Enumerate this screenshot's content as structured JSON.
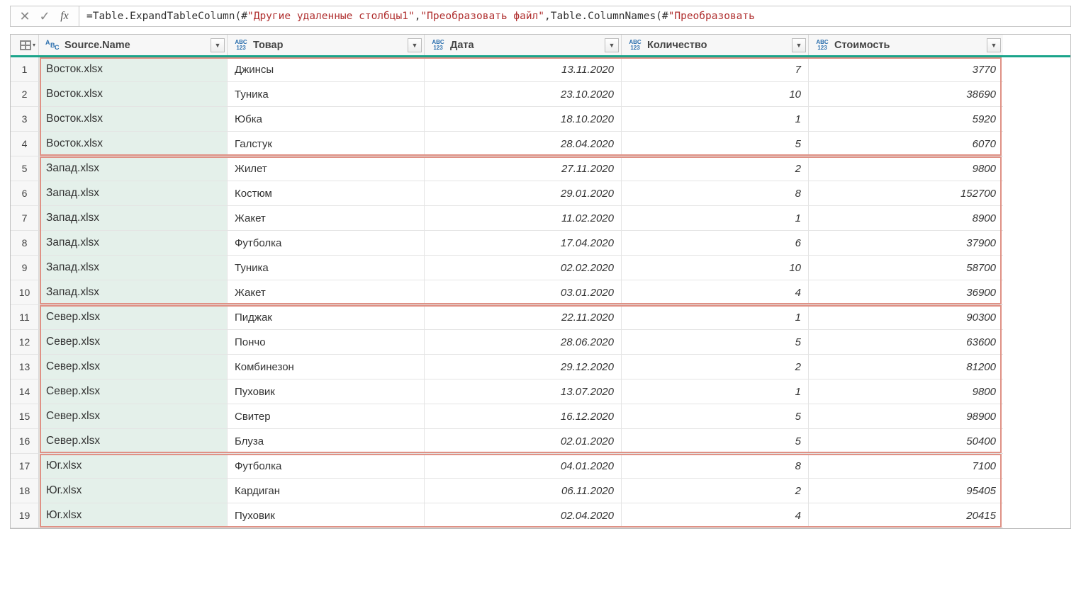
{
  "formulaBar": {
    "eq": "= ",
    "part1": "Table.ExpandTableColumn(#",
    "str1": "\"Другие удаленные столбцы1\"",
    "comma1": ", ",
    "str2": "\"Преобразовать файл\"",
    "comma2": ", ",
    "part2": "Table.ColumnNames(#",
    "str3": "\"Преобразовать"
  },
  "columns": [
    {
      "key": "source",
      "label": "Source.Name",
      "typeIcon": "abc",
      "wclass": "w-src",
      "align": "left",
      "srcCol": true
    },
    {
      "key": "tovar",
      "label": "Товар",
      "typeIcon": "any",
      "wclass": "w-tov",
      "align": "left",
      "srcCol": false
    },
    {
      "key": "date",
      "label": "Дата",
      "typeIcon": "any",
      "wclass": "w-dat",
      "align": "right",
      "srcCol": false
    },
    {
      "key": "qty",
      "label": "Количество",
      "typeIcon": "any",
      "wclass": "w-kol",
      "align": "right",
      "srcCol": false
    },
    {
      "key": "cost",
      "label": "Стоимость",
      "typeIcon": "any",
      "wclass": "w-sto",
      "align": "right",
      "srcCol": false
    }
  ],
  "rows": [
    {
      "source": "Восток.xlsx",
      "tovar": "Джинсы",
      "date": "13.11.2020",
      "qty": "7",
      "cost": "3770"
    },
    {
      "source": "Восток.xlsx",
      "tovar": "Туника",
      "date": "23.10.2020",
      "qty": "10",
      "cost": "38690"
    },
    {
      "source": "Восток.xlsx",
      "tovar": "Юбка",
      "date": "18.10.2020",
      "qty": "1",
      "cost": "5920"
    },
    {
      "source": "Восток.xlsx",
      "tovar": "Галстук",
      "date": "28.04.2020",
      "qty": "5",
      "cost": "6070"
    },
    {
      "source": "Запад.xlsx",
      "tovar": "Жилет",
      "date": "27.11.2020",
      "qty": "2",
      "cost": "9800"
    },
    {
      "source": "Запад.xlsx",
      "tovar": "Костюм",
      "date": "29.01.2020",
      "qty": "8",
      "cost": "152700"
    },
    {
      "source": "Запад.xlsx",
      "tovar": "Жакет",
      "date": "11.02.2020",
      "qty": "1",
      "cost": "8900"
    },
    {
      "source": "Запад.xlsx",
      "tovar": "Футболка",
      "date": "17.04.2020",
      "qty": "6",
      "cost": "37900"
    },
    {
      "source": "Запад.xlsx",
      "tovar": "Туника",
      "date": "02.02.2020",
      "qty": "10",
      "cost": "58700"
    },
    {
      "source": "Запад.xlsx",
      "tovar": "Жакет",
      "date": "03.01.2020",
      "qty": "4",
      "cost": "36900"
    },
    {
      "source": "Север.xlsx",
      "tovar": "Пиджак",
      "date": "22.11.2020",
      "qty": "1",
      "cost": "90300"
    },
    {
      "source": "Север.xlsx",
      "tovar": "Пончо",
      "date": "28.06.2020",
      "qty": "5",
      "cost": "63600"
    },
    {
      "source": "Север.xlsx",
      "tovar": "Комбинезон",
      "date": "29.12.2020",
      "qty": "2",
      "cost": "81200"
    },
    {
      "source": "Север.xlsx",
      "tovar": "Пуховик",
      "date": "13.07.2020",
      "qty": "1",
      "cost": "9800"
    },
    {
      "source": "Север.xlsx",
      "tovar": "Свитер",
      "date": "16.12.2020",
      "qty": "5",
      "cost": "98900"
    },
    {
      "source": "Север.xlsx",
      "tovar": "Блуза",
      "date": "02.01.2020",
      "qty": "5",
      "cost": "50400"
    },
    {
      "source": "Юг.xlsx",
      "tovar": "Футболка",
      "date": "04.01.2020",
      "qty": "8",
      "cost": "7100"
    },
    {
      "source": "Юг.xlsx",
      "tovar": "Кардиган",
      "date": "06.11.2020",
      "qty": "2",
      "cost": "95405"
    },
    {
      "source": "Юг.xlsx",
      "tovar": "Пуховик",
      "date": "02.04.2020",
      "qty": "4",
      "cost": "20415"
    }
  ],
  "groups": [
    {
      "startRow": 0,
      "endRow": 3
    },
    {
      "startRow": 4,
      "endRow": 9
    },
    {
      "startRow": 10,
      "endRow": 15
    },
    {
      "startRow": 16,
      "endRow": 18
    }
  ],
  "typeIconText": {
    "abc_l1": "A",
    "abc_l2": "B",
    "abc_l3": "C",
    "any_l1": "ABC",
    "any_l2": "123"
  }
}
